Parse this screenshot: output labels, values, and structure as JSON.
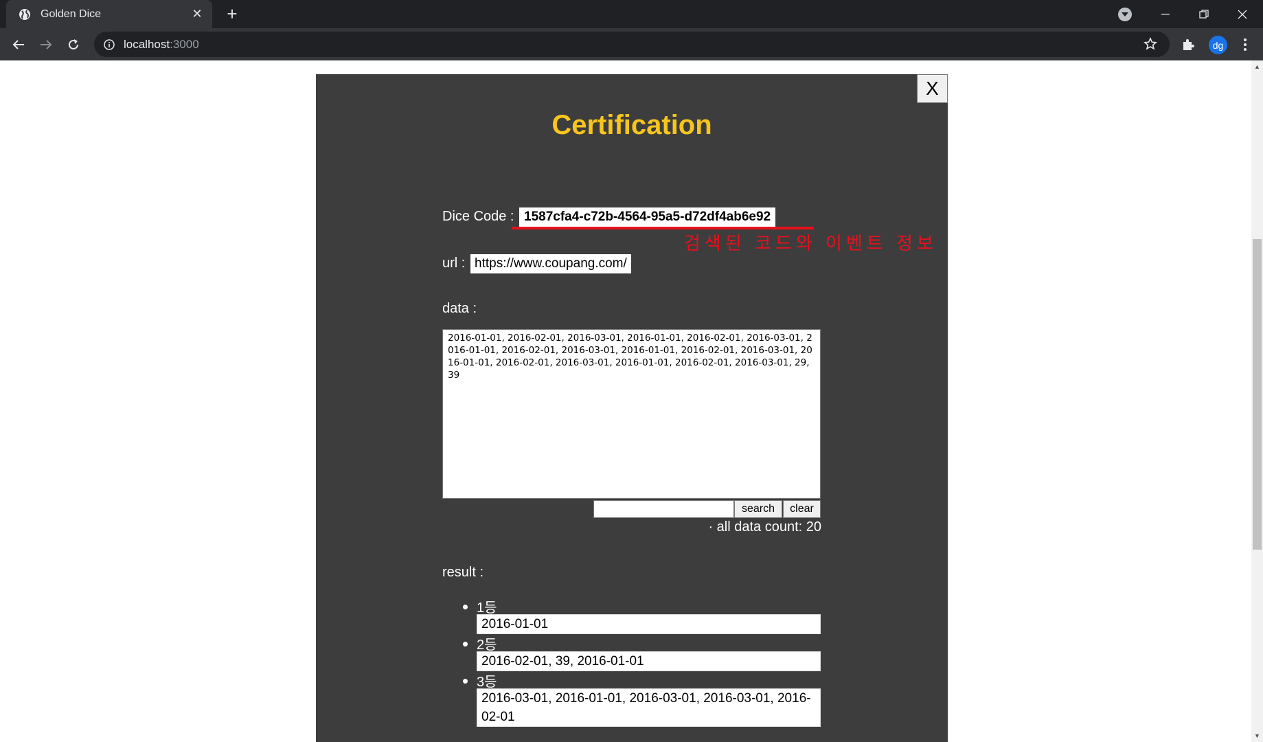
{
  "browser": {
    "tab_title": "Golden Dice",
    "url_host": "localhost",
    "url_port": ":3000",
    "profile_initials": "dg"
  },
  "modal": {
    "close_label": "X",
    "title": "Certification",
    "dice_code_label": "Dice Code :",
    "dice_code_value": "1587cfa4-c72b-4564-95a5-d72df4ab6e92",
    "annotation_text": "검색된 코드와 이벤트 정보",
    "url_label": "url :",
    "url_value": "https://www.coupang.com/",
    "data_label": "data :",
    "data_text": "2016-01-01, 2016-02-01, 2016-03-01, 2016-01-01, 2016-02-01, 2016-03-01, 2016-01-01, 2016-02-01, 2016-03-01, 2016-01-01, 2016-02-01, 2016-03-01, 2016-01-01, 2016-02-01, 2016-03-01, 2016-01-01, 2016-02-01, 2016-03-01, 29, 39",
    "search_input_value": "",
    "search_button": "search",
    "clear_button": "clear",
    "count_text": "· all data count: 20",
    "result_label": "result :",
    "results": [
      {
        "rank": "1등",
        "value": "2016-01-01"
      },
      {
        "rank": "2등",
        "value": "2016-02-01, 39, 2016-01-01"
      },
      {
        "rank": "3등",
        "value": "2016-03-01, 2016-01-01, 2016-03-01, 2016-03-01, 2016-02-01"
      }
    ]
  },
  "colors": {
    "title_accent": "#f8c51c",
    "annotation_red": "#e8101c",
    "modal_bg": "#3d3d3d"
  }
}
